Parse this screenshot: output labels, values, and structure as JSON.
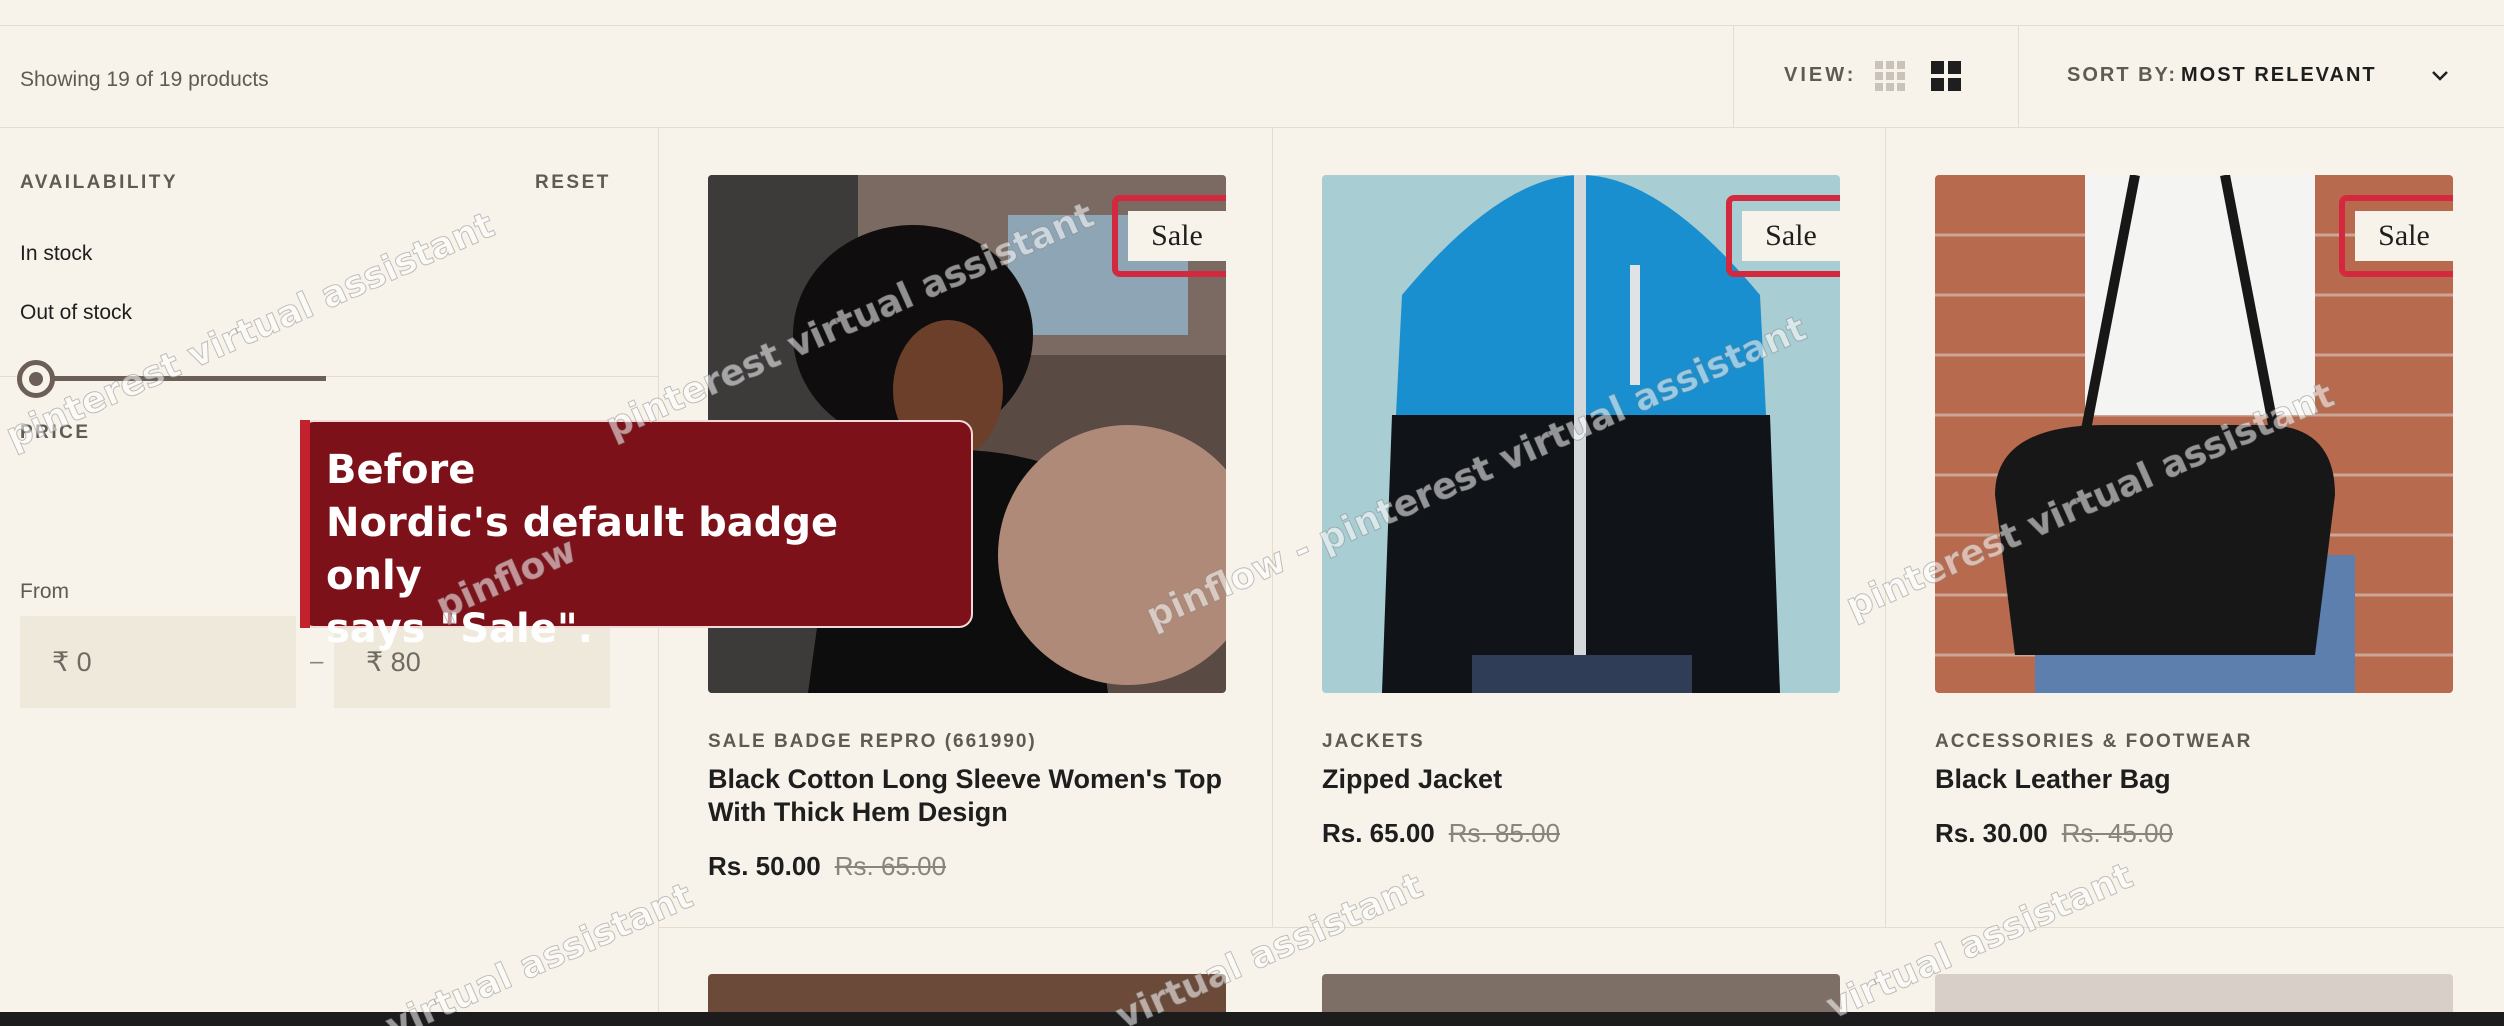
{
  "toolbar": {
    "count_text": "Showing 19 of 19 products",
    "view_label": "VIEW:",
    "sort_label": "SORT BY:",
    "sort_value": "MOST RELEVANT"
  },
  "filters": {
    "availability": {
      "heading": "AVAILABILITY",
      "reset": "RESET",
      "options": [
        "In stock",
        "Out of stock"
      ]
    },
    "price": {
      "heading": "PRICE",
      "from_label": "From",
      "dash": "–",
      "min": "₹ 0",
      "max": "₹ 80"
    }
  },
  "tooltip": {
    "line1": "Before",
    "line2": "Nordic's default badge only",
    "line3": "says \"Sale\"."
  },
  "products": [
    {
      "vendor": "SALE BADGE REPRO (661990)",
      "title": "Black Cotton Long Sleeve Women's Top With Thick Hem Design",
      "price": "Rs. 50.00",
      "compare_price": "Rs. 65.00",
      "badge": "Sale"
    },
    {
      "vendor": "JACKETS",
      "title": "Zipped Jacket",
      "price": "Rs. 65.00",
      "compare_price": "Rs. 85.00",
      "badge": "Sale"
    },
    {
      "vendor": "ACCESSORIES & FOOTWEAR",
      "title": "Black Leather Bag",
      "price": "Rs. 30.00",
      "compare_price": "Rs. 45.00",
      "badge": "Sale"
    }
  ],
  "watermarks": [
    "pinterest virtual assistant",
    "pinterest virtual assistant",
    "pinflow - pinterest virtual assistant",
    "pinterest virtual assistant",
    "pinflow - pinterest virtual assistant",
    "pinflow",
    "virtual assistant",
    "virtual assistant",
    "virtual assistant"
  ],
  "icons": {
    "grid_small": "grid-4-icon",
    "grid_large": "grid-2-icon",
    "chevron": "chevron-down-icon"
  },
  "colors": {
    "background": "#f8f3ea",
    "badge_highlight": "#d3293f",
    "tooltip_bg": "#7d1119"
  }
}
